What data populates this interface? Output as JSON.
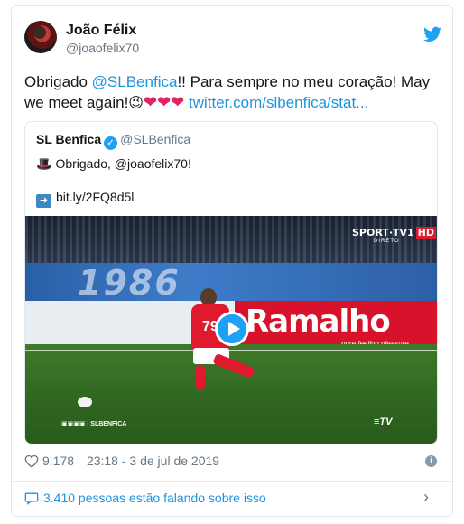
{
  "author": {
    "name": "João Félix",
    "handle": "@joaofelix70"
  },
  "tweet": {
    "text_before": "Obrigado ",
    "mention": "@SLBenfica",
    "text_after": "!! Para sempre no meu coração! May we meet again!",
    "link": "twitter.com/slbenfica/stat..."
  },
  "quoted": {
    "name": "SL Benfica",
    "handle": "@SLBenfica",
    "line1": "Obrigado, @joaofelix70!",
    "line2": "bit.ly/2FQ8d5l",
    "video": {
      "tv_brand": "SPORT·TV",
      "tv_channel": "1",
      "tv_hd": "HD",
      "tv_live": "DIRETO",
      "board_text": "1986",
      "ad_text": "Ramalho",
      "ad_sub": "pure feeling pleasure",
      "player_number": "79",
      "social_handle": "| SLBENFICA",
      "btv": "≡TV"
    }
  },
  "meta": {
    "likes": "9.178",
    "timestamp": "23:18 - 3 de jul de 2019"
  },
  "footer": {
    "conversation": "3.410 pessoas estão falando sobre isso"
  },
  "colors": {
    "link": "#1b95e0",
    "heart": "#e0245e",
    "benfica_red": "#e0192f"
  }
}
